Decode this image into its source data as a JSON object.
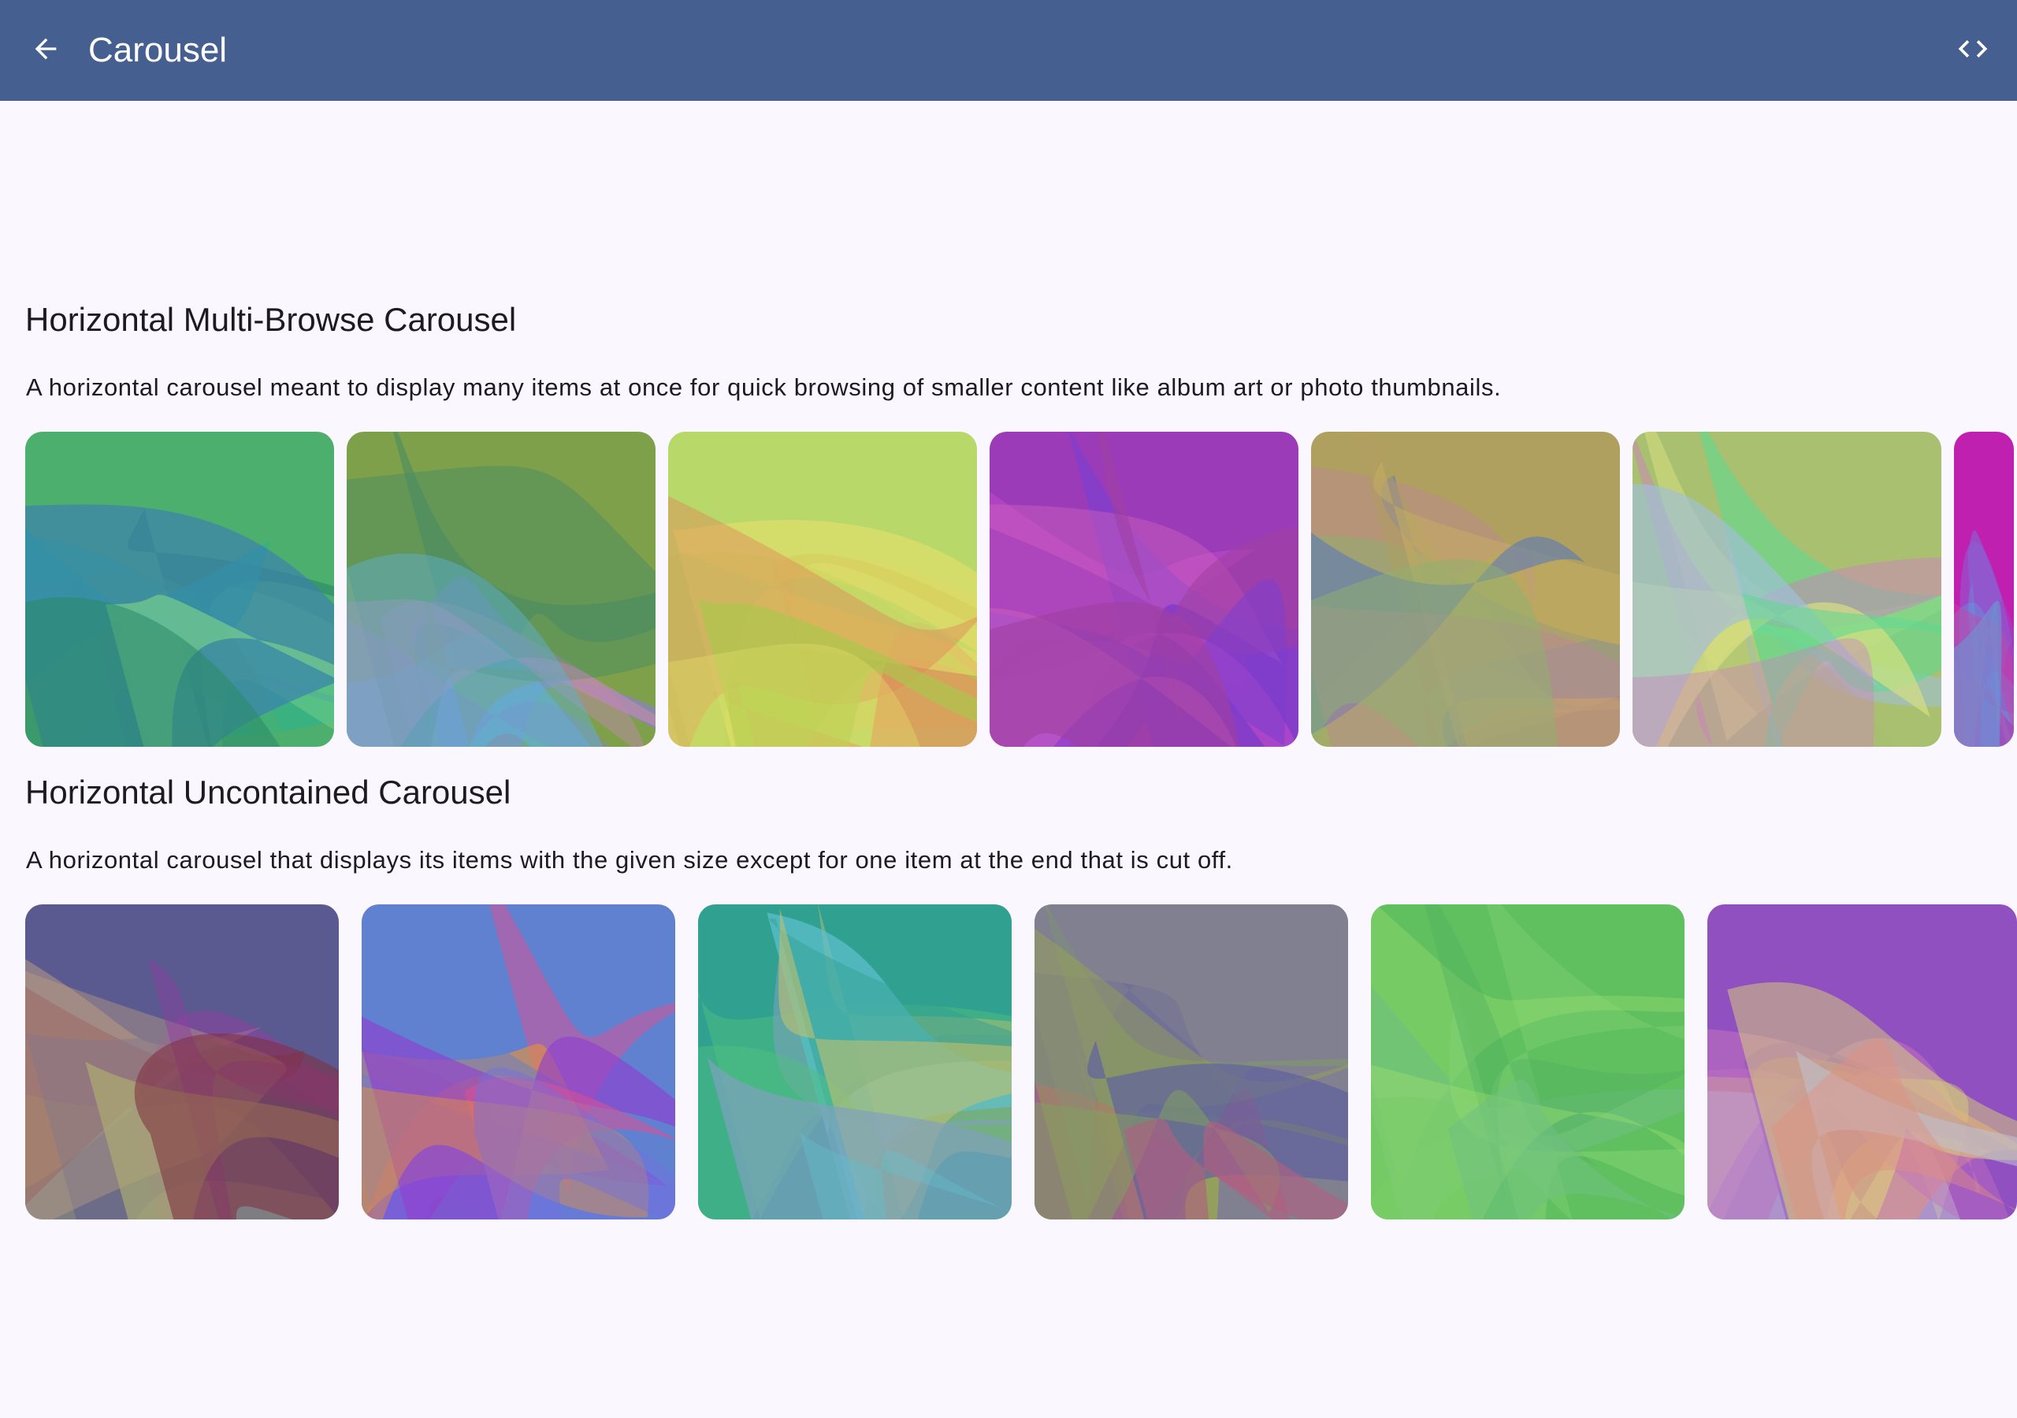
{
  "app_bar": {
    "title": "Carousel",
    "back_icon": "arrow-back-icon",
    "code_icon": "code-icon",
    "background": "#455f90"
  },
  "sections": [
    {
      "title": "Horizontal Multi-Browse Carousel",
      "description": "A horizontal carousel meant to display many items at once for quick browsing of smaller content like album art or photo thumbnails."
    },
    {
      "title": "Horizontal Uncontained Carousel",
      "description": "A horizontal carousel that displays its items with the given size except for one item at the end that is cut off."
    }
  ]
}
